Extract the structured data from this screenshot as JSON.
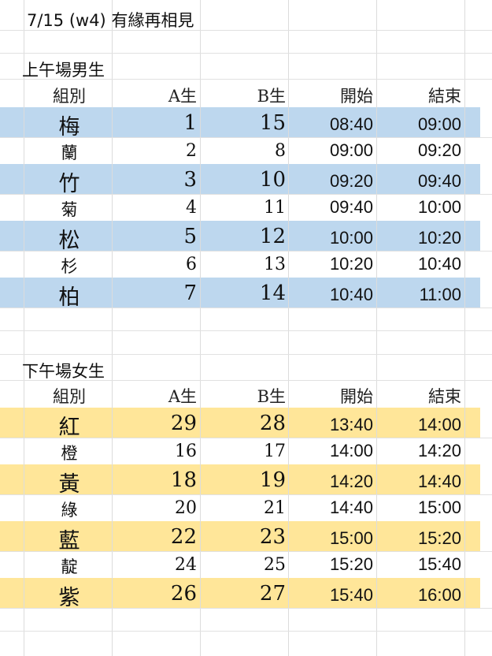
{
  "title": {
    "date": "7/15 (w4)",
    "text": "有緣再相見"
  },
  "morning": {
    "heading": "上午場男生",
    "columns": {
      "group": "組別",
      "a": "A生",
      "b": "B生",
      "start": "開始",
      "end": "結束"
    },
    "rows": [
      {
        "group": "梅",
        "a": "1",
        "b": "15",
        "start": "08:40",
        "end": "09:00",
        "highlight": true
      },
      {
        "group": "蘭",
        "a": "2",
        "b": "8",
        "start": "09:00",
        "end": "09:20",
        "highlight": false
      },
      {
        "group": "竹",
        "a": "3",
        "b": "10",
        "start": "09:20",
        "end": "09:40",
        "highlight": true
      },
      {
        "group": "菊",
        "a": "4",
        "b": "11",
        "start": "09:40",
        "end": "10:00",
        "highlight": false
      },
      {
        "group": "松",
        "a": "5",
        "b": "12",
        "start": "10:00",
        "end": "10:20",
        "highlight": true
      },
      {
        "group": "杉",
        "a": "6",
        "b": "13",
        "start": "10:20",
        "end": "10:40",
        "highlight": false
      },
      {
        "group": "柏",
        "a": "7",
        "b": "14",
        "start": "10:40",
        "end": "11:00",
        "highlight": true
      }
    ]
  },
  "afternoon": {
    "heading": "下午場女生",
    "columns": {
      "group": "組別",
      "a": "A生",
      "b": "B生",
      "start": "開始",
      "end": "結束"
    },
    "rows": [
      {
        "group": "紅",
        "a": "29",
        "b": "28",
        "start": "13:40",
        "end": "14:00",
        "highlight": true
      },
      {
        "group": "橙",
        "a": "16",
        "b": "17",
        "start": "14:00",
        "end": "14:20",
        "highlight": false
      },
      {
        "group": "黃",
        "a": "18",
        "b": "19",
        "start": "14:20",
        "end": "14:40",
        "highlight": true
      },
      {
        "group": "綠",
        "a": "20",
        "b": "21",
        "start": "14:40",
        "end": "15:00",
        "highlight": false
      },
      {
        "group": "藍",
        "a": "22",
        "b": "23",
        "start": "15:00",
        "end": "15:20",
        "highlight": true
      },
      {
        "group": "靛",
        "a": "24",
        "b": "25",
        "start": "15:20",
        "end": "15:40",
        "highlight": false
      },
      {
        "group": "紫",
        "a": "26",
        "b": "27",
        "start": "15:40",
        "end": "16:00",
        "highlight": true
      }
    ]
  },
  "colors": {
    "morning_band": "#bdd7ee",
    "afternoon_band": "#ffe699",
    "gridline": "#dcdcdc"
  }
}
